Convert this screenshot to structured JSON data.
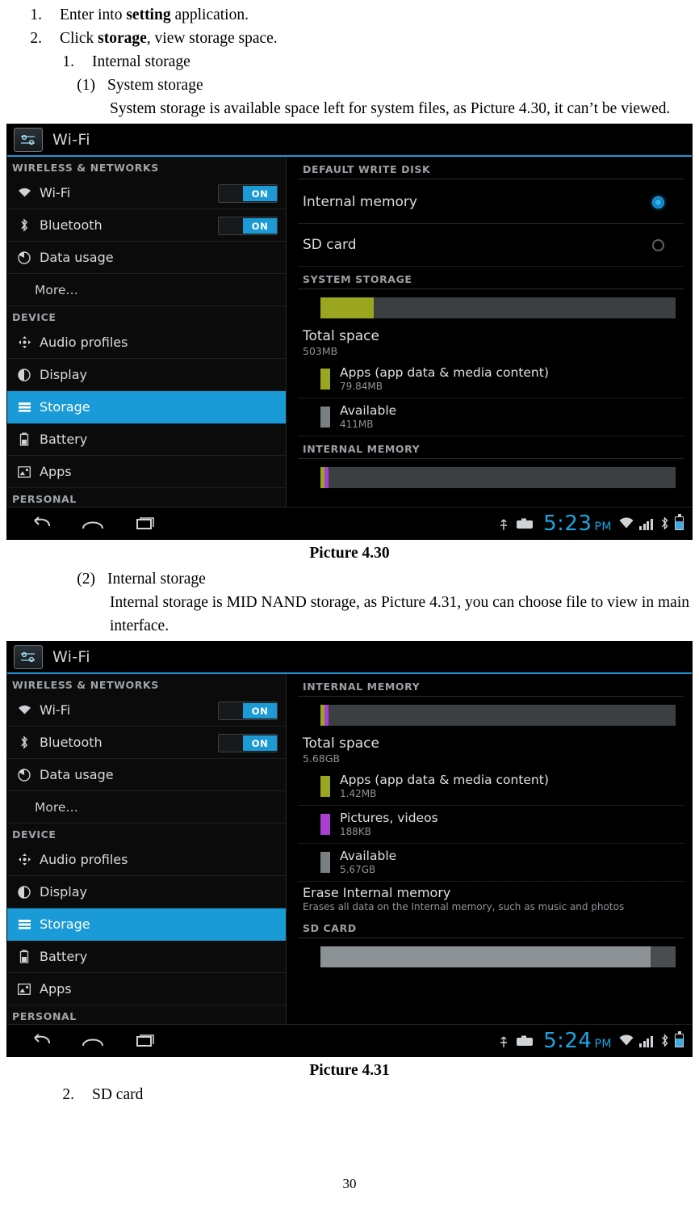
{
  "doc": {
    "steps": [
      {
        "num": "1.",
        "parts": [
          {
            "t": "Enter into ",
            "b": false
          },
          {
            "t": "setting",
            "b": true
          },
          {
            "t": " application.",
            "b": false
          }
        ]
      },
      {
        "num": "2.",
        "parts": [
          {
            "t": "Click ",
            "b": false
          },
          {
            "t": "storage",
            "b": true
          },
          {
            "t": ", view storage space.",
            "b": false
          }
        ]
      }
    ],
    "sub1_num": "1.",
    "sub1_text": "Internal storage",
    "item1_num": "(1)",
    "item1_title": "System storage",
    "item1_body": "System storage is available space left for system files, as Picture 4.30, it can’t be viewed.",
    "caption1": "Picture 4.30",
    "item2_num": "(2)",
    "item2_title": "Internal storage",
    "item2_body": "Internal storage is MID NAND storage, as Picture 4.31, you can choose file to view in main interface.",
    "caption2": "Picture 4.31",
    "sub2_num": "2.",
    "sub2_text": "SD card",
    "page_number": "30"
  },
  "shot1": {
    "title": "Wi-Fi",
    "sidebar": {
      "group1": "WIRELESS & NETWORKS",
      "items1": [
        {
          "label": "Wi-Fi",
          "icon": "wifi-icon",
          "toggle": "ON"
        },
        {
          "label": "Bluetooth",
          "icon": "bluetooth-icon",
          "toggle": "ON"
        },
        {
          "label": "Data usage",
          "icon": "data-usage-icon"
        },
        {
          "label": "More…",
          "icon": "none"
        }
      ],
      "group2": "DEVICE",
      "items2": [
        {
          "label": "Audio profiles",
          "icon": "audio-profiles-icon"
        },
        {
          "label": "Display",
          "icon": "display-icon"
        },
        {
          "label": "Storage",
          "icon": "storage-icon",
          "selected": true
        },
        {
          "label": "Battery",
          "icon": "battery-icon"
        },
        {
          "label": "Apps",
          "icon": "apps-icon"
        }
      ],
      "group3": "PERSONAL"
    },
    "right": {
      "section_write": "DEFAULT WRITE DISK",
      "radio_internal": "Internal memory",
      "radio_sd": "SD card",
      "section_system": "SYSTEM STORAGE",
      "total_label": "Total space",
      "total_value": "503MB",
      "rows": [
        {
          "name": "Apps (app data & media content)",
          "size": "79.84MB",
          "color": "#9aa520"
        },
        {
          "name": "Available",
          "size": "411MB",
          "color": "#7a7f83"
        }
      ],
      "section_internal": "INTERNAL MEMORY"
    },
    "nav": {
      "time": "5:23",
      "ampm": "PM"
    }
  },
  "shot2": {
    "title": "Wi-Fi",
    "sidebar": {
      "group1": "WIRELESS & NETWORKS",
      "items1": [
        {
          "label": "Wi-Fi",
          "icon": "wifi-icon",
          "toggle": "ON"
        },
        {
          "label": "Bluetooth",
          "icon": "bluetooth-icon",
          "toggle": "ON"
        },
        {
          "label": "Data usage",
          "icon": "data-usage-icon"
        },
        {
          "label": "More…",
          "icon": "none"
        }
      ],
      "group2": "DEVICE",
      "items2": [
        {
          "label": "Audio profiles",
          "icon": "audio-profiles-icon"
        },
        {
          "label": "Display",
          "icon": "display-icon"
        },
        {
          "label": "Storage",
          "icon": "storage-icon",
          "selected": true
        },
        {
          "label": "Battery",
          "icon": "battery-icon"
        },
        {
          "label": "Apps",
          "icon": "apps-icon"
        }
      ],
      "group3": "PERSONAL"
    },
    "right": {
      "section_internal": "INTERNAL MEMORY",
      "total_label": "Total space",
      "total_value": "5.68GB",
      "rows": [
        {
          "name": "Apps (app data & media content)",
          "size": "1.42MB",
          "color": "#9aa520"
        },
        {
          "name": "Pictures, videos",
          "size": "188KB",
          "color": "#a83fd0"
        },
        {
          "name": "Available",
          "size": "5.67GB",
          "color": "#7a7f83"
        }
      ],
      "erase_title": "Erase Internal memory",
      "erase_sub": "Erases all data on the Internal memory, such as music and photos",
      "section_sd": "SD CARD"
    },
    "nav": {
      "time": "5:24",
      "ampm": "PM"
    }
  }
}
